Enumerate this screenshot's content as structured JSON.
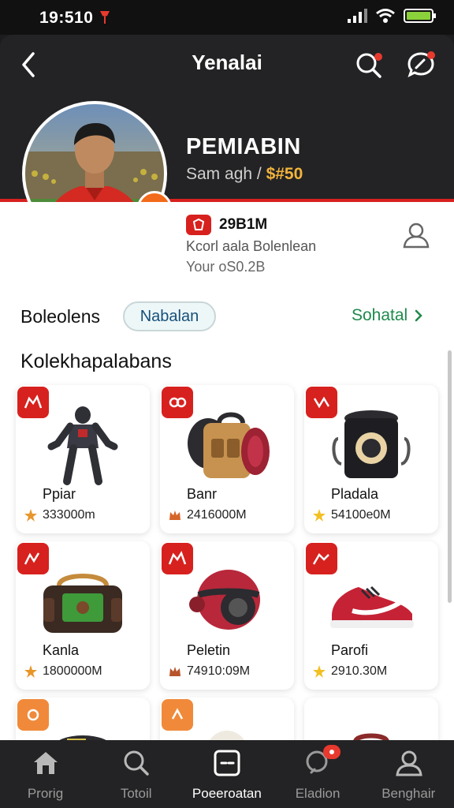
{
  "status_bar": {
    "time": "19:510"
  },
  "header": {
    "title": "Yenalai"
  },
  "profile": {
    "name": "PEMIABIN",
    "subtitle_prefix": "Sam agh / ",
    "subtitle_amount": "$#50",
    "stat_value": "29B1M",
    "stat_line1": "Kcorl aala Bolenlean",
    "stat_line2": "Your oS0.2B"
  },
  "filter": {
    "section_title": "Boleolens",
    "chip_label": "Nabalan",
    "see_all_label": "Sohatal"
  },
  "collection": {
    "title": "Kolekhapalabans",
    "items": [
      {
        "name": "Ppiar",
        "price": "333000m",
        "badge_color": "#d7211e"
      },
      {
        "name": "Banr",
        "price": "2416000M",
        "badge_color": "#d7211e"
      },
      {
        "name": "Pladala",
        "price": "54100e0M",
        "badge_color": "#d7211e"
      },
      {
        "name": "Kanla",
        "price": "1800000M",
        "badge_color": "#d7211e"
      },
      {
        "name": "Peletin",
        "price": "74910:09M",
        "badge_color": "#d7211e"
      },
      {
        "name": "Parofi",
        "price": "2910.30M",
        "badge_color": "#d7211e"
      }
    ]
  },
  "bottom_nav": {
    "items": [
      {
        "label": "Prorig",
        "icon": "home-icon"
      },
      {
        "label": "Totoil",
        "icon": "search-icon"
      },
      {
        "label": "Poeeroatan",
        "icon": "collection-icon"
      },
      {
        "label": "Eladion",
        "icon": "chat-icon"
      },
      {
        "label": "Benghair",
        "icon": "profile-icon"
      }
    ]
  },
  "colors": {
    "brand_red": "#d7211e",
    "accent_orange": "#f26a1b",
    "gold": "#f2b43c",
    "link_green": "#1e8a4c",
    "dark_bg": "#232325"
  }
}
